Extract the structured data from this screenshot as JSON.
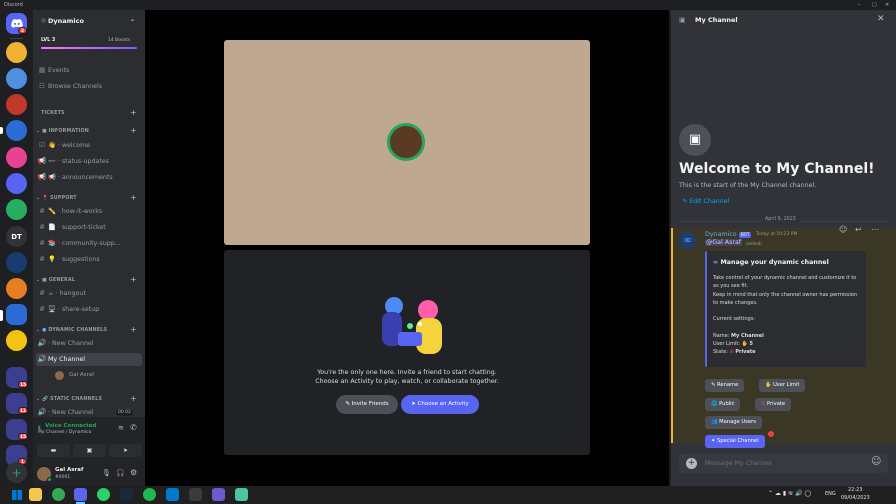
{
  "window": {
    "title": "Discord"
  },
  "rail": {
    "dt_label": "DT",
    "badges": {
      "b1": "2",
      "b2": "15",
      "b3": "11",
      "b4": "15",
      "b5": "1"
    }
  },
  "server": {
    "name": "Dynamico",
    "level": "LVL 3",
    "boosts": "14 Boosts"
  },
  "nav": {
    "events": "Events",
    "browse": "Browse Channels"
  },
  "categories": {
    "tickets": "TICKETS",
    "information": "INFORMATION",
    "support": "SUPPORT",
    "general": "GENERAL",
    "dynamic": "DYNAMIC CHANNELS",
    "static": "STATIC CHANNELS"
  },
  "channels": {
    "welcome": "welcome",
    "status": "status-updates",
    "announcements": "announcements",
    "howitworks": "how-it-works",
    "ticket": "support-ticket",
    "community": "community-supp...",
    "suggestions": "suggestions",
    "hangout": "hangout",
    "sharesetup": "share-setup",
    "newchannel1": "New Channel",
    "mychannel": "My Channel",
    "voiceuser": "Gal Asraf",
    "newchannel2": "New Channel",
    "counter": "00",
    "limit": "02"
  },
  "voice": {
    "status": "Voice Connected",
    "location": "My Channel / Dynamico"
  },
  "user": {
    "name": "Gal Asraf",
    "tag": "#0001"
  },
  "stage": {
    "empty_line1": "You're the only one here. Invite a friend to start chatting.",
    "empty_line2": "Choose an Activity to play, watch, or collaborate together.",
    "invite_label": "Invite Friends",
    "activity_label": "Choose an Activity"
  },
  "panel": {
    "header_title": "My Channel",
    "welcome_title": "Welcome to My Channel!",
    "welcome_sub": "This is the start of the My Channel channel.",
    "edit_label": "Edit Channel",
    "date_divider": "April 9, 2023",
    "composer_placeholder": "Message My Channel"
  },
  "message": {
    "author": "Dynamico",
    "bot_tag": "BOT",
    "time": "Today at 10:23 PM",
    "mention": "@Gal Asraf",
    "edited": "(edited)",
    "embed_title": "Manage your dynamic channel",
    "embed_p1": "Take control of your dynamic channel and customize it to as you see fit.",
    "embed_p2": "Keep in mind that only the channel owner has permission to make changes.",
    "settings_heading": "Current settings:",
    "name_label": "Name:",
    "name_value": "My Channel",
    "limit_label": "User Limit:",
    "limit_value": "5",
    "state_label": "State:",
    "state_value": "Private"
  },
  "actions": {
    "rename": "Rename",
    "user_limit": "User Limit",
    "public": "Public",
    "private": "Private",
    "manage_users": "Manage Users",
    "special": "Special Channel"
  },
  "tray": {
    "lang": "ENG",
    "time": "22:23",
    "date": "09/04/2023"
  },
  "colors": {
    "accent": "#5865f2",
    "green": "#23a55a",
    "red": "#f23f43",
    "mention_bg": "#3b3725",
    "mention_bar": "#f0b232"
  }
}
